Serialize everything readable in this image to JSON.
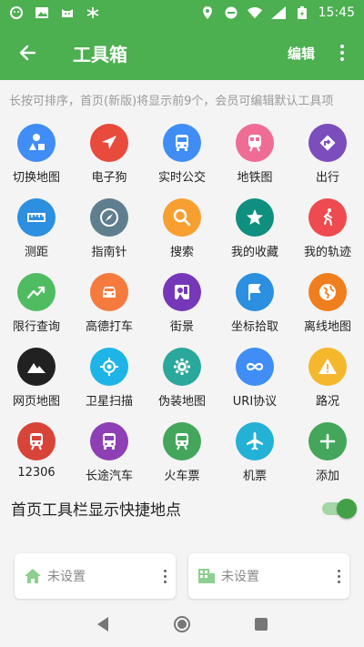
{
  "status": {
    "time": "15:45"
  },
  "header": {
    "title": "工具箱",
    "edit_label": "编辑"
  },
  "hint": "长按可排序，首页(新版)将显示前9个，会员可编辑默认工具项",
  "tools": [
    {
      "label": "切换地图",
      "color": "#3f8df5",
      "icon": "shapes-icon"
    },
    {
      "label": "电子狗",
      "color": "#e84a3c",
      "icon": "navigation-arrow-icon"
    },
    {
      "label": "实时公交",
      "color": "#3f8df5",
      "icon": "bus-icon"
    },
    {
      "label": "地铁图",
      "color": "#ef6c95",
      "icon": "subway-icon"
    },
    {
      "label": "出行",
      "color": "#7c4dbd",
      "icon": "directions-icon"
    },
    {
      "label": "测距",
      "color": "#2c8fe0",
      "icon": "ruler-icon"
    },
    {
      "label": "指南针",
      "color": "#5f7e8e",
      "icon": "compass-icon"
    },
    {
      "label": "搜索",
      "color": "#f7a031",
      "icon": "search-icon"
    },
    {
      "label": "我的收藏",
      "color": "#0f8f7f",
      "icon": "star-icon"
    },
    {
      "label": "我的轨迹",
      "color": "#ef4a4f",
      "icon": "running-icon"
    },
    {
      "label": "限行查询",
      "color": "#4fbc62",
      "icon": "trend-icon"
    },
    {
      "label": "高德打车",
      "color": "#f57a3d",
      "icon": "car-icon"
    },
    {
      "label": "街景",
      "color": "#7637b8",
      "icon": "streetview-icon"
    },
    {
      "label": "坐标拾取",
      "color": "#2c8fe0",
      "icon": "flag-icon"
    },
    {
      "label": "离线地图",
      "color": "#ef7f1e",
      "icon": "globe-icon"
    },
    {
      "label": "网页地图",
      "color": "#212121",
      "icon": "mountain-icon"
    },
    {
      "label": "卫星扫描",
      "color": "#1fb4e8",
      "icon": "crosshair-icon"
    },
    {
      "label": "伪装地图",
      "color": "#2aa89b",
      "icon": "gear-icon"
    },
    {
      "label": "URI协议",
      "color": "#3f8df5",
      "icon": "infinity-icon"
    },
    {
      "label": "路况",
      "color": "#f5b82c",
      "icon": "warning-icon"
    },
    {
      "label": "12306",
      "color": "#d84438",
      "icon": "train-icon"
    },
    {
      "label": "长途汽车",
      "color": "#8e3fb5",
      "icon": "coach-icon"
    },
    {
      "label": "火车票",
      "color": "#43a65b",
      "icon": "train-ticket-icon"
    },
    {
      "label": "机票",
      "color": "#23b1d6",
      "icon": "airplane-icon"
    },
    {
      "label": "添加",
      "color": "#43a65b",
      "icon": "plus-icon"
    }
  ],
  "toggle": {
    "label": "首页工具栏显示快捷地点",
    "on": true
  },
  "places": [
    {
      "label": "未设置",
      "icon": "home-icon"
    },
    {
      "label": "未设置",
      "icon": "office-icon"
    }
  ]
}
